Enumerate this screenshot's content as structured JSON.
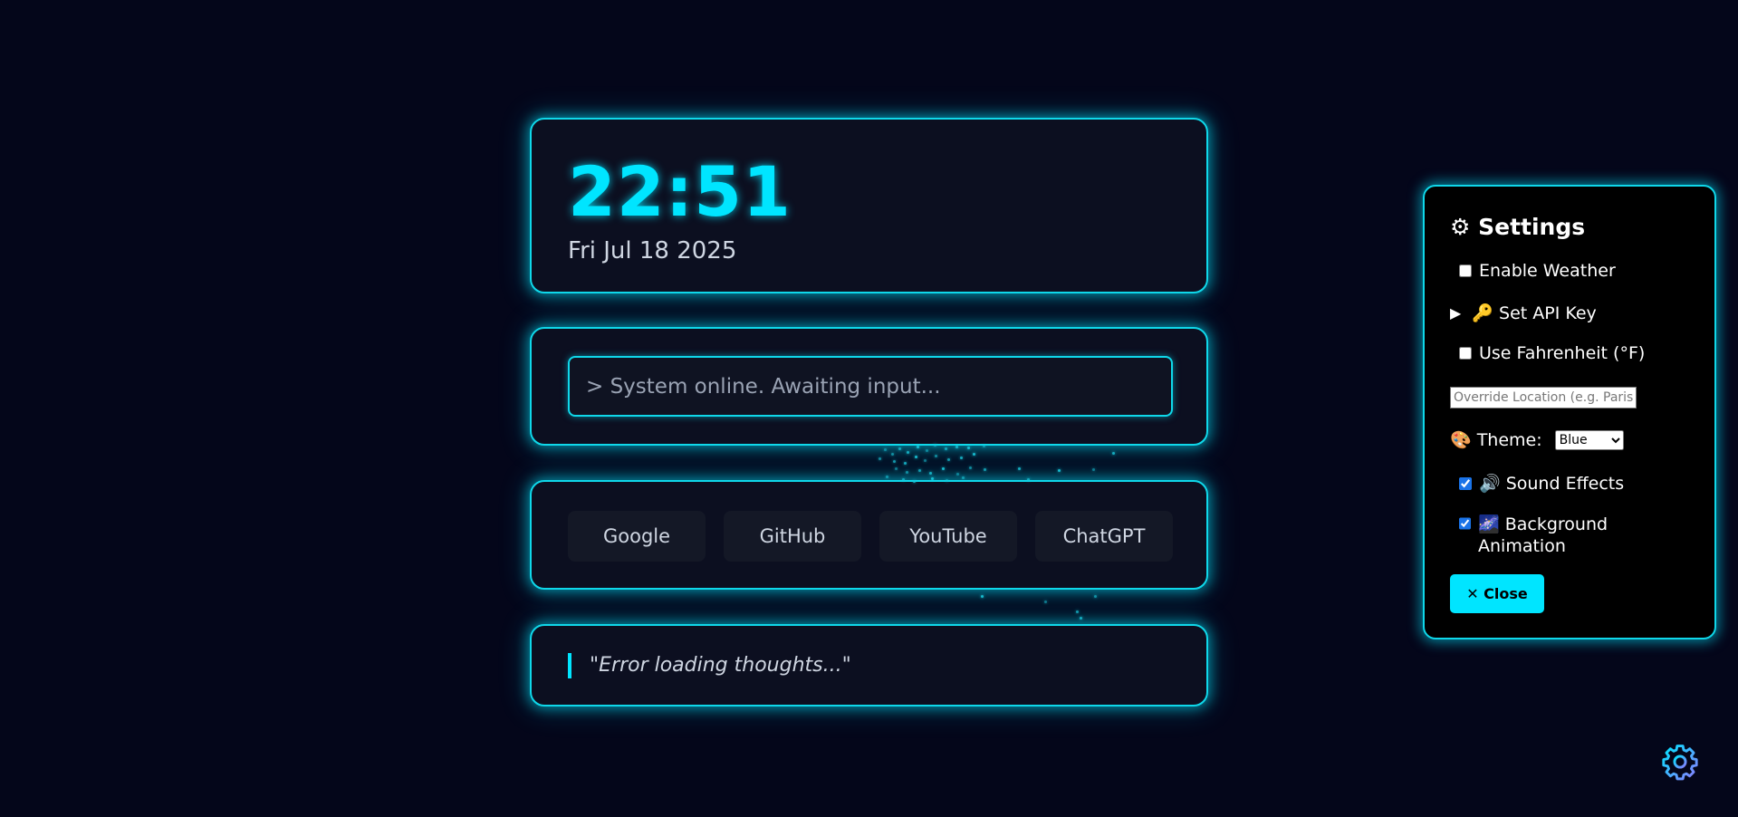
{
  "clock": {
    "time": "22:51",
    "date": "Fri Jul 18 2025"
  },
  "command": {
    "placeholder": "> System online. Awaiting input..."
  },
  "links": [
    {
      "label": "Google"
    },
    {
      "label": "GitHub"
    },
    {
      "label": "YouTube"
    },
    {
      "label": "ChatGPT"
    }
  ],
  "thought": {
    "text": "\"Error loading thoughts...\""
  },
  "settings": {
    "title": "⚙ Settings",
    "enable_weather": {
      "label": "Enable Weather",
      "checked": false
    },
    "api_key": {
      "label": "🔑 Set API Key"
    },
    "fahrenheit": {
      "label": "Use Fahrenheit (°F)",
      "checked": false
    },
    "location": {
      "placeholder": "Override Location (e.g. Paris)"
    },
    "theme": {
      "label": "🎨 Theme:",
      "selected": "Blue"
    },
    "sound": {
      "label": "🔊 Sound Effects",
      "checked": true
    },
    "bg_anim": {
      "label": "🌌 Background Animation",
      "checked": true
    },
    "close_label": "✕ Close"
  },
  "colors": {
    "accent": "#00e5ff",
    "background": "#04061a",
    "card": "#0c0f20"
  },
  "icons": {
    "settings_fab": "gear-icon"
  }
}
